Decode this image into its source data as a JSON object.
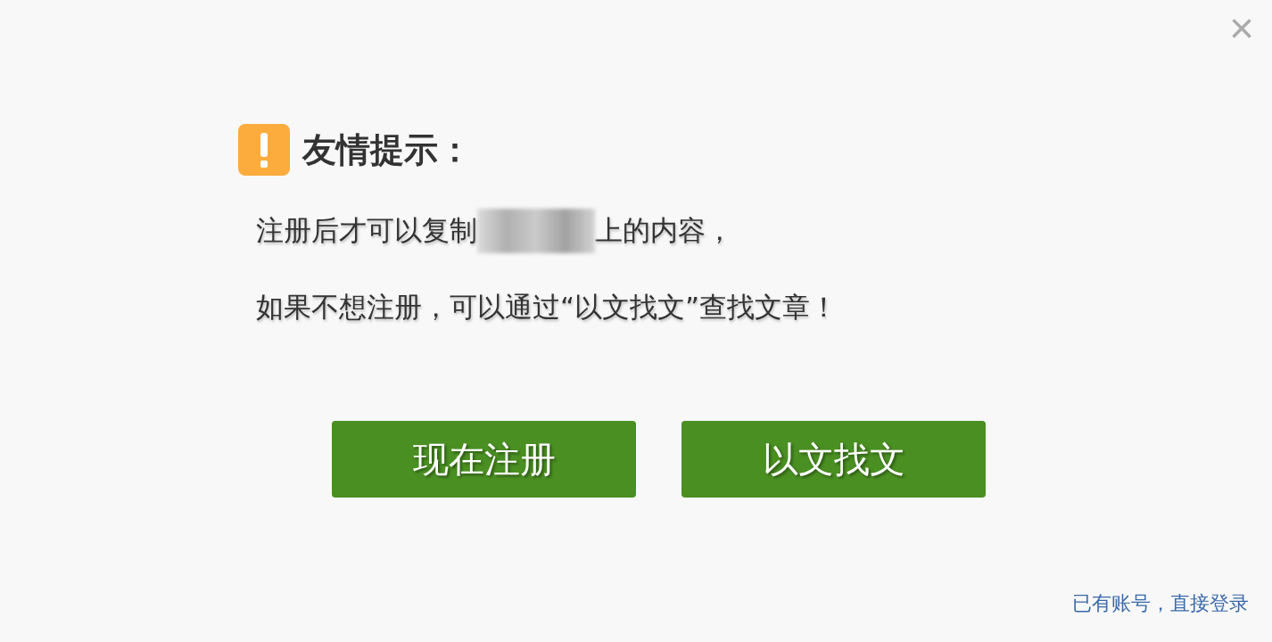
{
  "close": {
    "glyph": "×"
  },
  "title": "友情提示：",
  "message": {
    "line1_before": "注册后才可以复制",
    "redacted": true,
    "line1_after": "上的内容，",
    "line2": "如果不想注册，可以通过“以文找文”查找文章！"
  },
  "buttons": [
    {
      "label": "现在注册"
    },
    {
      "label": "以文找文"
    }
  ],
  "login_link": "已有账号，直接登录"
}
